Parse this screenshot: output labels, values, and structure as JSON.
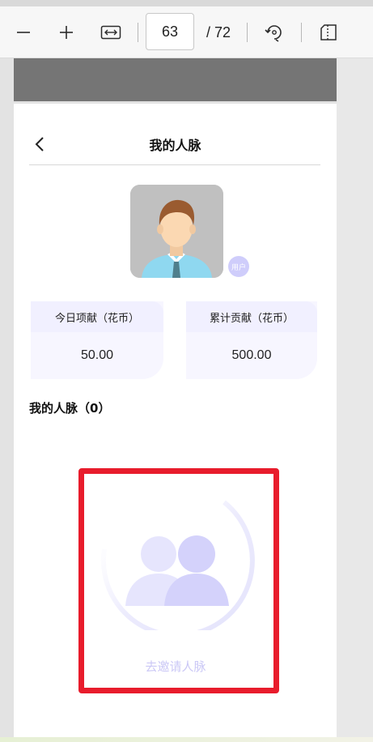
{
  "viewer": {
    "zoom_out_icon": "minus-icon",
    "zoom_in_icon": "plus-icon",
    "fit_width_icon": "fit-width-icon",
    "current_page": "63",
    "total_pages": "/ 72",
    "rotate_icon": "rotate-icon",
    "page_view_icon": "page-view-icon"
  },
  "app": {
    "back_icon": "chevron-left-icon",
    "title": "我的人脉",
    "avatar_icon": "user-avatar-icon",
    "role_badge": "用户",
    "stats": [
      {
        "label": "今日项献（花币）",
        "value": "50.00"
      },
      {
        "label": "累计贡献（花币）",
        "value": "500.00"
      }
    ],
    "section_title": "我的人脉（0）",
    "empty_icon": "people-group-icon",
    "invite_label": "去邀请人脉"
  },
  "colors": {
    "accent_purple": "#d4d2fb",
    "badge_purple": "#cfcdfb",
    "highlight_red": "#e81c2c",
    "card_bg": "#f7f6ff"
  }
}
